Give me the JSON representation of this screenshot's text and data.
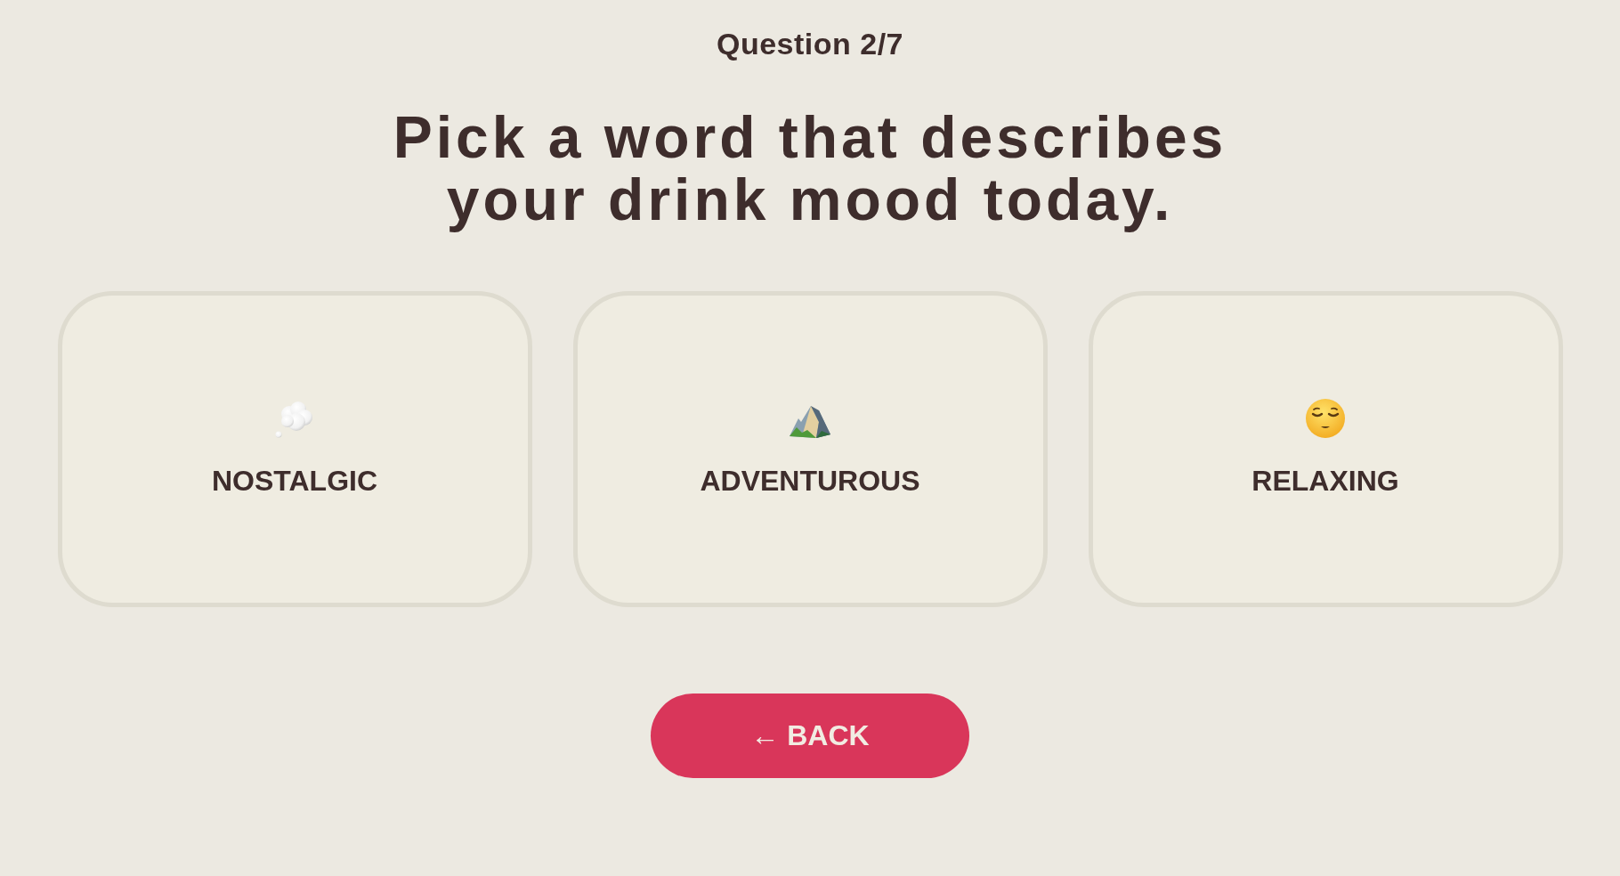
{
  "progress": {
    "label": "Question 2/7"
  },
  "question": {
    "title": "Pick a word that describes your drink mood today."
  },
  "options": [
    {
      "label": "NOSTALGIC",
      "selected": false
    },
    {
      "label": "ADVENTUROUS",
      "selected": false
    },
    {
      "label": "RELAXING",
      "selected": false
    }
  ],
  "back_button": {
    "label": "← BACK"
  }
}
